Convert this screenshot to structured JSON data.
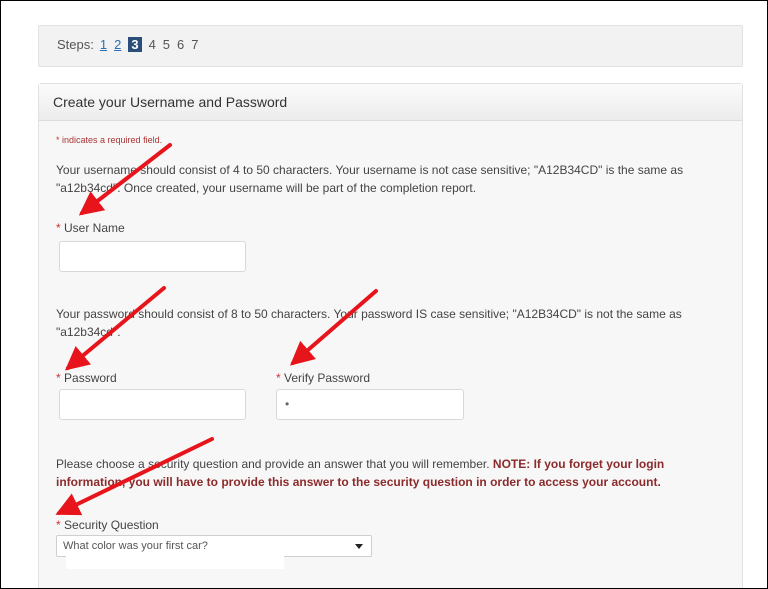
{
  "steps": {
    "label": "Steps:",
    "items": [
      {
        "num": "1",
        "state": "link"
      },
      {
        "num": "2",
        "state": "link"
      },
      {
        "num": "3",
        "state": "current"
      },
      {
        "num": "4",
        "state": "plain"
      },
      {
        "num": "5",
        "state": "plain"
      },
      {
        "num": "6",
        "state": "plain"
      },
      {
        "num": "7",
        "state": "plain"
      }
    ]
  },
  "panel": {
    "title": "Create your Username and Password",
    "required_star": "*",
    "required_note": " indicates a required field.",
    "username_help": "Your username should consist of 4 to 50 characters. Your username is not case sensitive; \"A12B34CD\" is the same as \"a12b34cd\". Once created, your username will be part of the completion report.",
    "username_label": "User Name",
    "password_help": "Your password should consist of 8 to 50 characters. Your password IS case sensitive; \"A12B34CD\" is not the same as \"a12b34cd\".",
    "password_label": "Password",
    "verify_label": "Verify Password",
    "verify_value": "•",
    "security_help": "Please choose a security question and provide an answer that you will remember. ",
    "security_warn": "NOTE: If you forget your login information, you will have to provide this answer to the security question in order to access your account.",
    "security_label": "Security Question",
    "security_value": "What color was your first car?"
  },
  "colors": {
    "annotation_arrow": "#e8141b",
    "current_step_bg": "#2a4d7a",
    "link": "#2f6db5",
    "required": "#c33333"
  }
}
